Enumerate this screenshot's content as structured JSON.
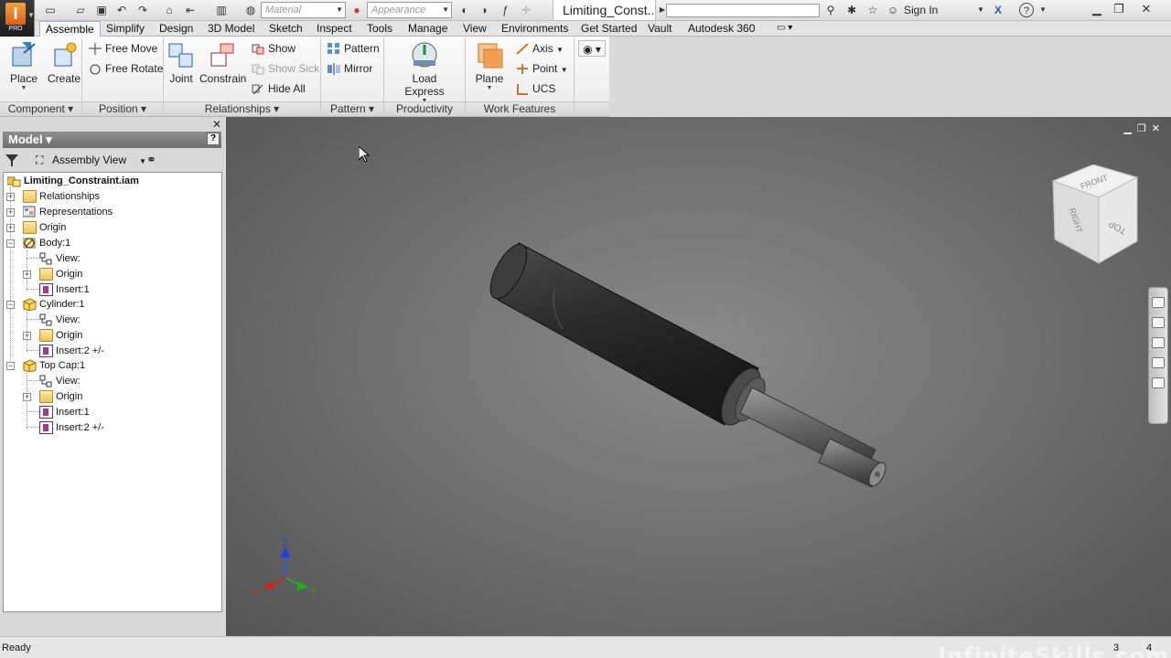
{
  "app": {
    "logo_letter": "I",
    "edition": "PRO"
  },
  "title_bar": {
    "material_placeholder": "Material",
    "appearance_placeholder": "Appearance",
    "document_title": "Limiting_Const...",
    "sign_in": "Sign In",
    "help": "?"
  },
  "tabs": [
    "Assemble",
    "Simplify",
    "Design",
    "3D Model",
    "Sketch",
    "Inspect",
    "Tools",
    "Manage",
    "View",
    "Environments",
    "Get Started",
    "Vault",
    "Autodesk 360"
  ],
  "ribbon": {
    "component": {
      "label": "Component",
      "place": "Place",
      "create": "Create"
    },
    "position": {
      "label": "Position",
      "free_move": "Free Move",
      "free_rotate": "Free Rotate"
    },
    "relationships": {
      "label": "Relationships",
      "joint": "Joint",
      "constrain": "Constrain",
      "show": "Show",
      "show_sick": "Show Sick",
      "hide_all": "Hide All"
    },
    "pattern": {
      "label": "Pattern",
      "pattern": "Pattern",
      "mirror": "Mirror"
    },
    "productivity": {
      "label": "Productivity",
      "load_express": "Load Express"
    },
    "work_features": {
      "label": "Work Features",
      "plane": "Plane",
      "axis": "Axis",
      "point": "Point",
      "ucs": "UCS"
    }
  },
  "browser": {
    "title": "Model",
    "view_select": "Assembly View",
    "tree": [
      {
        "label": "Limiting_Constraint.iam"
      },
      {
        "label": "Relationships"
      },
      {
        "label": "Representations"
      },
      {
        "label": "Origin"
      },
      {
        "label": "Body:1"
      },
      {
        "label": "View:"
      },
      {
        "label": "Origin"
      },
      {
        "label": "Insert:1"
      },
      {
        "label": "Cylinder:1"
      },
      {
        "label": "View:"
      },
      {
        "label": "Origin"
      },
      {
        "label": "Insert:2 +/-"
      },
      {
        "label": "Top Cap:1"
      },
      {
        "label": "View:"
      },
      {
        "label": "Origin"
      },
      {
        "label": "Insert:1"
      },
      {
        "label": "Insert:2 +/-"
      }
    ]
  },
  "viewcube": {
    "front": "FRONT",
    "right": "RIGHT",
    "top": "TOP"
  },
  "triad": {
    "x": "X",
    "y": "Y",
    "z": "Z"
  },
  "watermark": "InfiniteSkills.com",
  "status": {
    "text": "Ready",
    "n1": "3",
    "n2": "4"
  }
}
